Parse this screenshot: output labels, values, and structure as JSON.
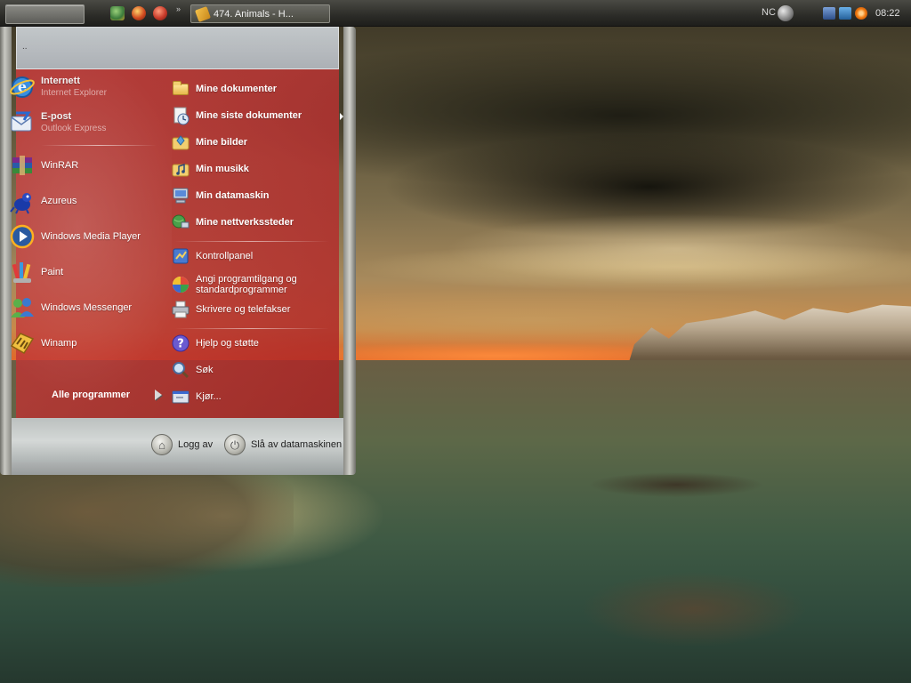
{
  "taskbar": {
    "task_button_label": "474. Animals - H...",
    "quick_launch_expand": "»",
    "tray": {
      "language": "NC",
      "clock": "08:22"
    }
  },
  "start_menu": {
    "header_text": "..",
    "left_items": [
      {
        "title": "Internett",
        "subtitle": "Internet Explorer",
        "icon": "internet-explorer-icon"
      },
      {
        "title": "E-post",
        "subtitle": "Outlook Express",
        "icon": "outlook-express-icon"
      },
      {
        "title": "WinRAR",
        "icon": "winrar-icon"
      },
      {
        "title": "Azureus",
        "icon": "azureus-icon"
      },
      {
        "title": "Windows Media Player",
        "icon": "media-player-icon"
      },
      {
        "title": "Paint",
        "icon": "paint-icon"
      },
      {
        "title": "Windows Messenger",
        "icon": "messenger-icon"
      },
      {
        "title": "Winamp",
        "icon": "winamp-icon"
      }
    ],
    "all_programs_label": "Alle programmer",
    "right_items": [
      {
        "label": "Mine dokumenter",
        "icon": "my-documents-icon"
      },
      {
        "label": "Mine siste dokumenter",
        "icon": "recent-documents-icon"
      },
      {
        "label": "Mine bilder",
        "icon": "my-pictures-icon"
      },
      {
        "label": "Min musikk",
        "icon": "my-music-icon"
      },
      {
        "label": "Min datamaskin",
        "icon": "my-computer-icon"
      },
      {
        "label": "Mine nettverkssteder",
        "icon": "network-places-icon"
      },
      {
        "label": "Kontrollpanel",
        "icon": "control-panel-icon"
      },
      {
        "label": "Angi programtilgang og standardprogrammer",
        "line1": "Angi programtilgang og",
        "line2": "standardprogrammer",
        "icon": "program-access-icon"
      },
      {
        "label": "Skrivere og telefakser",
        "icon": "printers-icon"
      },
      {
        "label": "Hjelp og støtte",
        "icon": "help-icon"
      },
      {
        "label": "Søk",
        "icon": "search-icon"
      },
      {
        "label": "Kjør...",
        "icon": "run-icon"
      }
    ],
    "footer": {
      "log_off_label": "Logg av",
      "shutdown_label": "Slå av datamaskinen"
    }
  }
}
